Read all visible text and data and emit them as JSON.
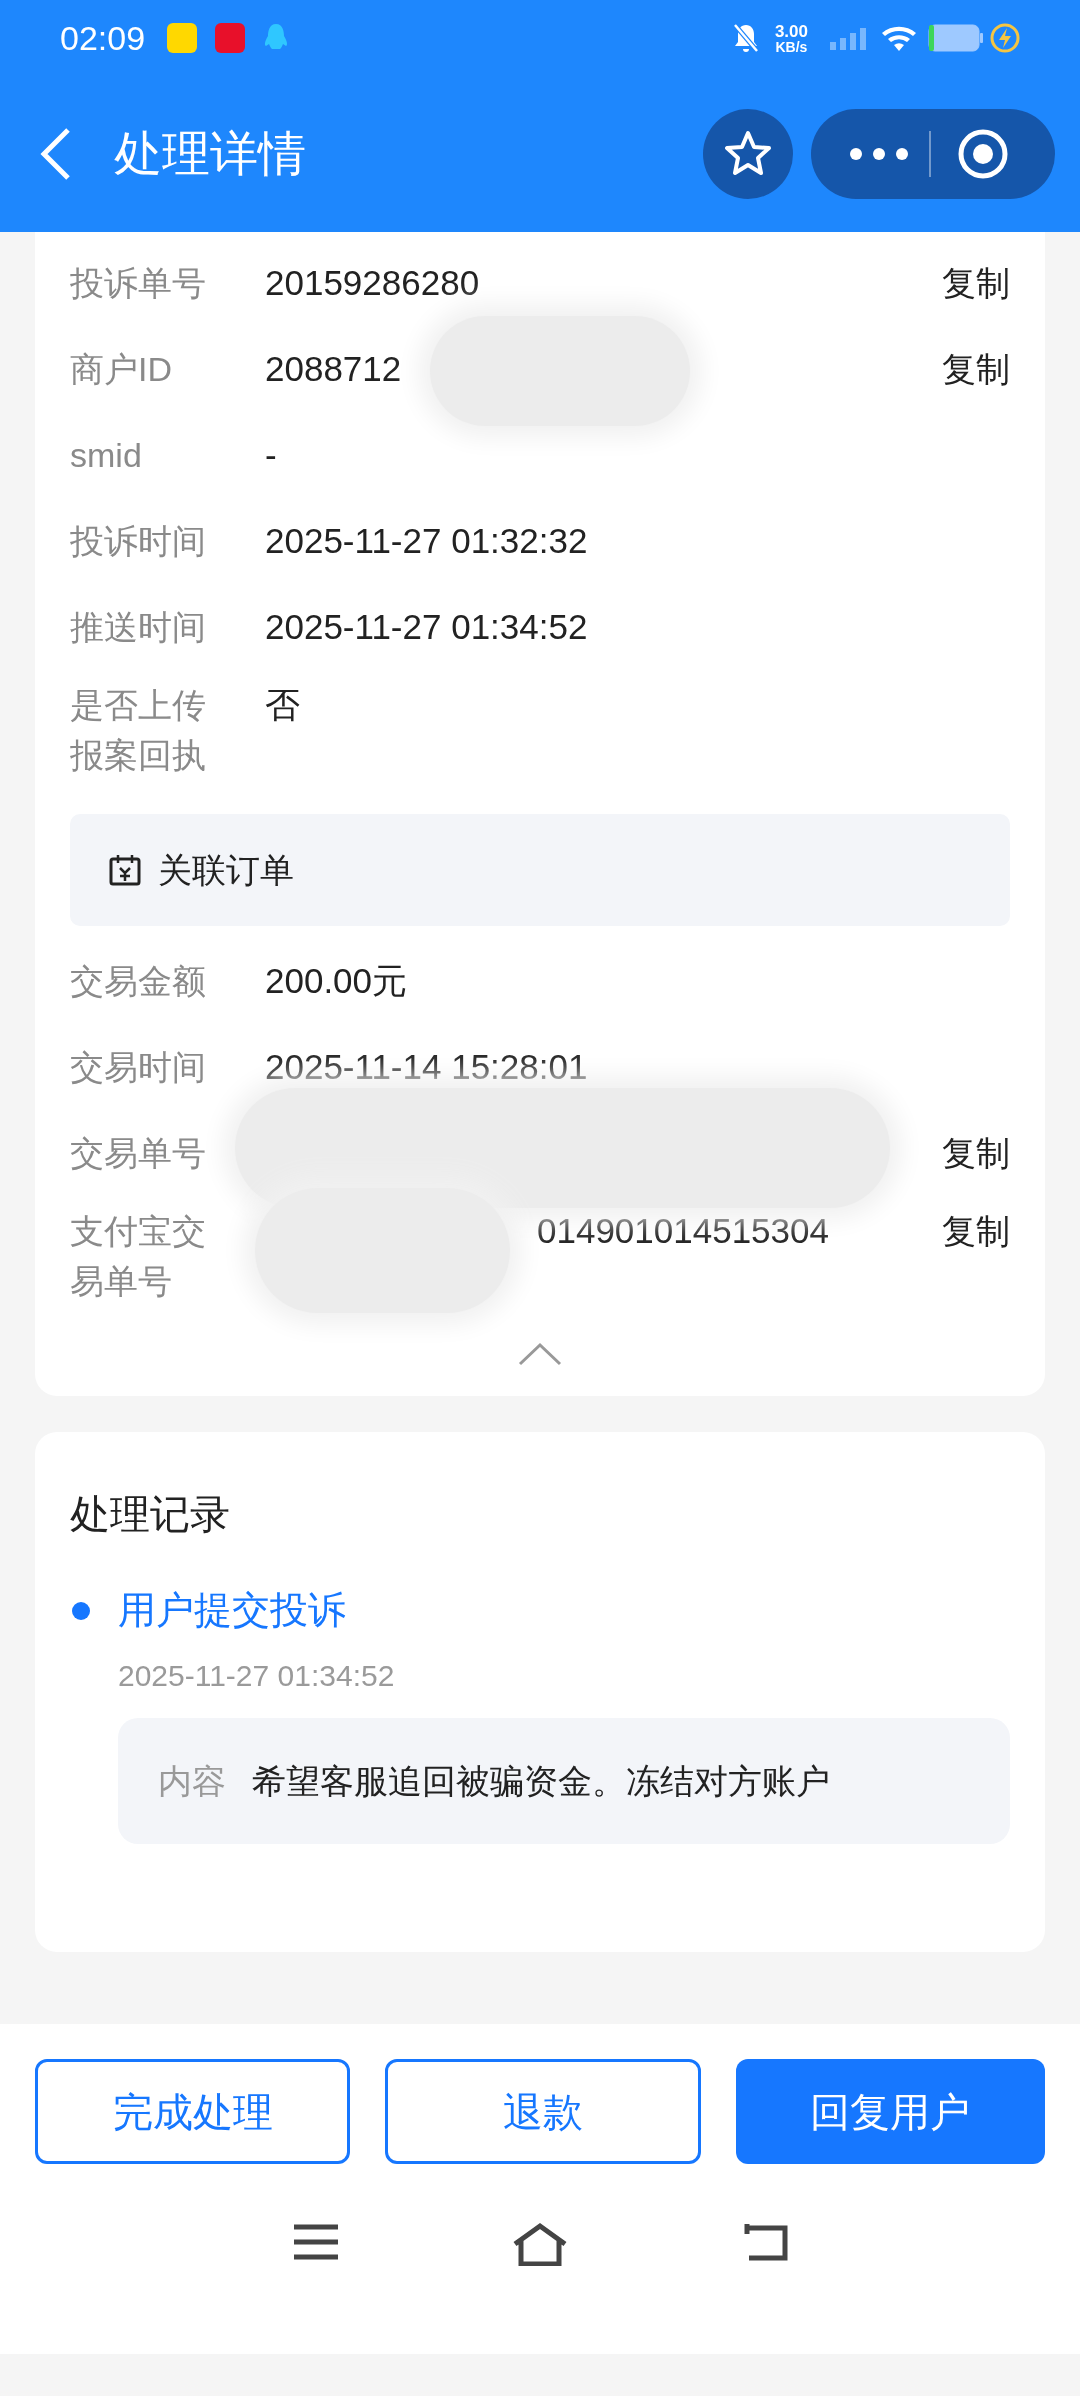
{
  "status_bar": {
    "time": "02:09",
    "net_speed": "3.00",
    "net_unit": "KB/s"
  },
  "header": {
    "title": "处理详情"
  },
  "details": [
    {
      "label": "投诉单号",
      "value": "20159286280",
      "copy": "复制"
    },
    {
      "label": "商户ID",
      "value": "2088712",
      "copy": "复制",
      "redacted": true,
      "kind": "trailing"
    },
    {
      "label": "smid",
      "value": "-"
    },
    {
      "label": "投诉时间",
      "value": "2025-11-27 01:32:32"
    },
    {
      "label": "推送时间",
      "value": "2025-11-27 01:34:52"
    },
    {
      "label": "是否上传报案回执",
      "value": "否"
    }
  ],
  "related_order": {
    "title": "关联订单"
  },
  "order_details": [
    {
      "label": "交易金额",
      "value": "200.00元"
    },
    {
      "label": "交易时间",
      "value": "2025-11-14 15:28:01"
    },
    {
      "label": "交易单号",
      "copy": "复制",
      "redacted": true,
      "kind": "full"
    },
    {
      "label": "支付宝交易单号",
      "value": "014901014515304",
      "copy": "复制",
      "redacted": true,
      "kind": "leading"
    }
  ],
  "records": {
    "title": "处理记录",
    "items": [
      {
        "title": "用户提交投诉",
        "time": "2025-11-27 01:34:52",
        "content_label": "内容",
        "content": "希望客服追回被骗资金。冻结对方账户"
      }
    ]
  },
  "actions": [
    {
      "label": "完成处理",
      "primary": false
    },
    {
      "label": "退款",
      "primary": false
    },
    {
      "label": "回复用户",
      "primary": true
    }
  ]
}
